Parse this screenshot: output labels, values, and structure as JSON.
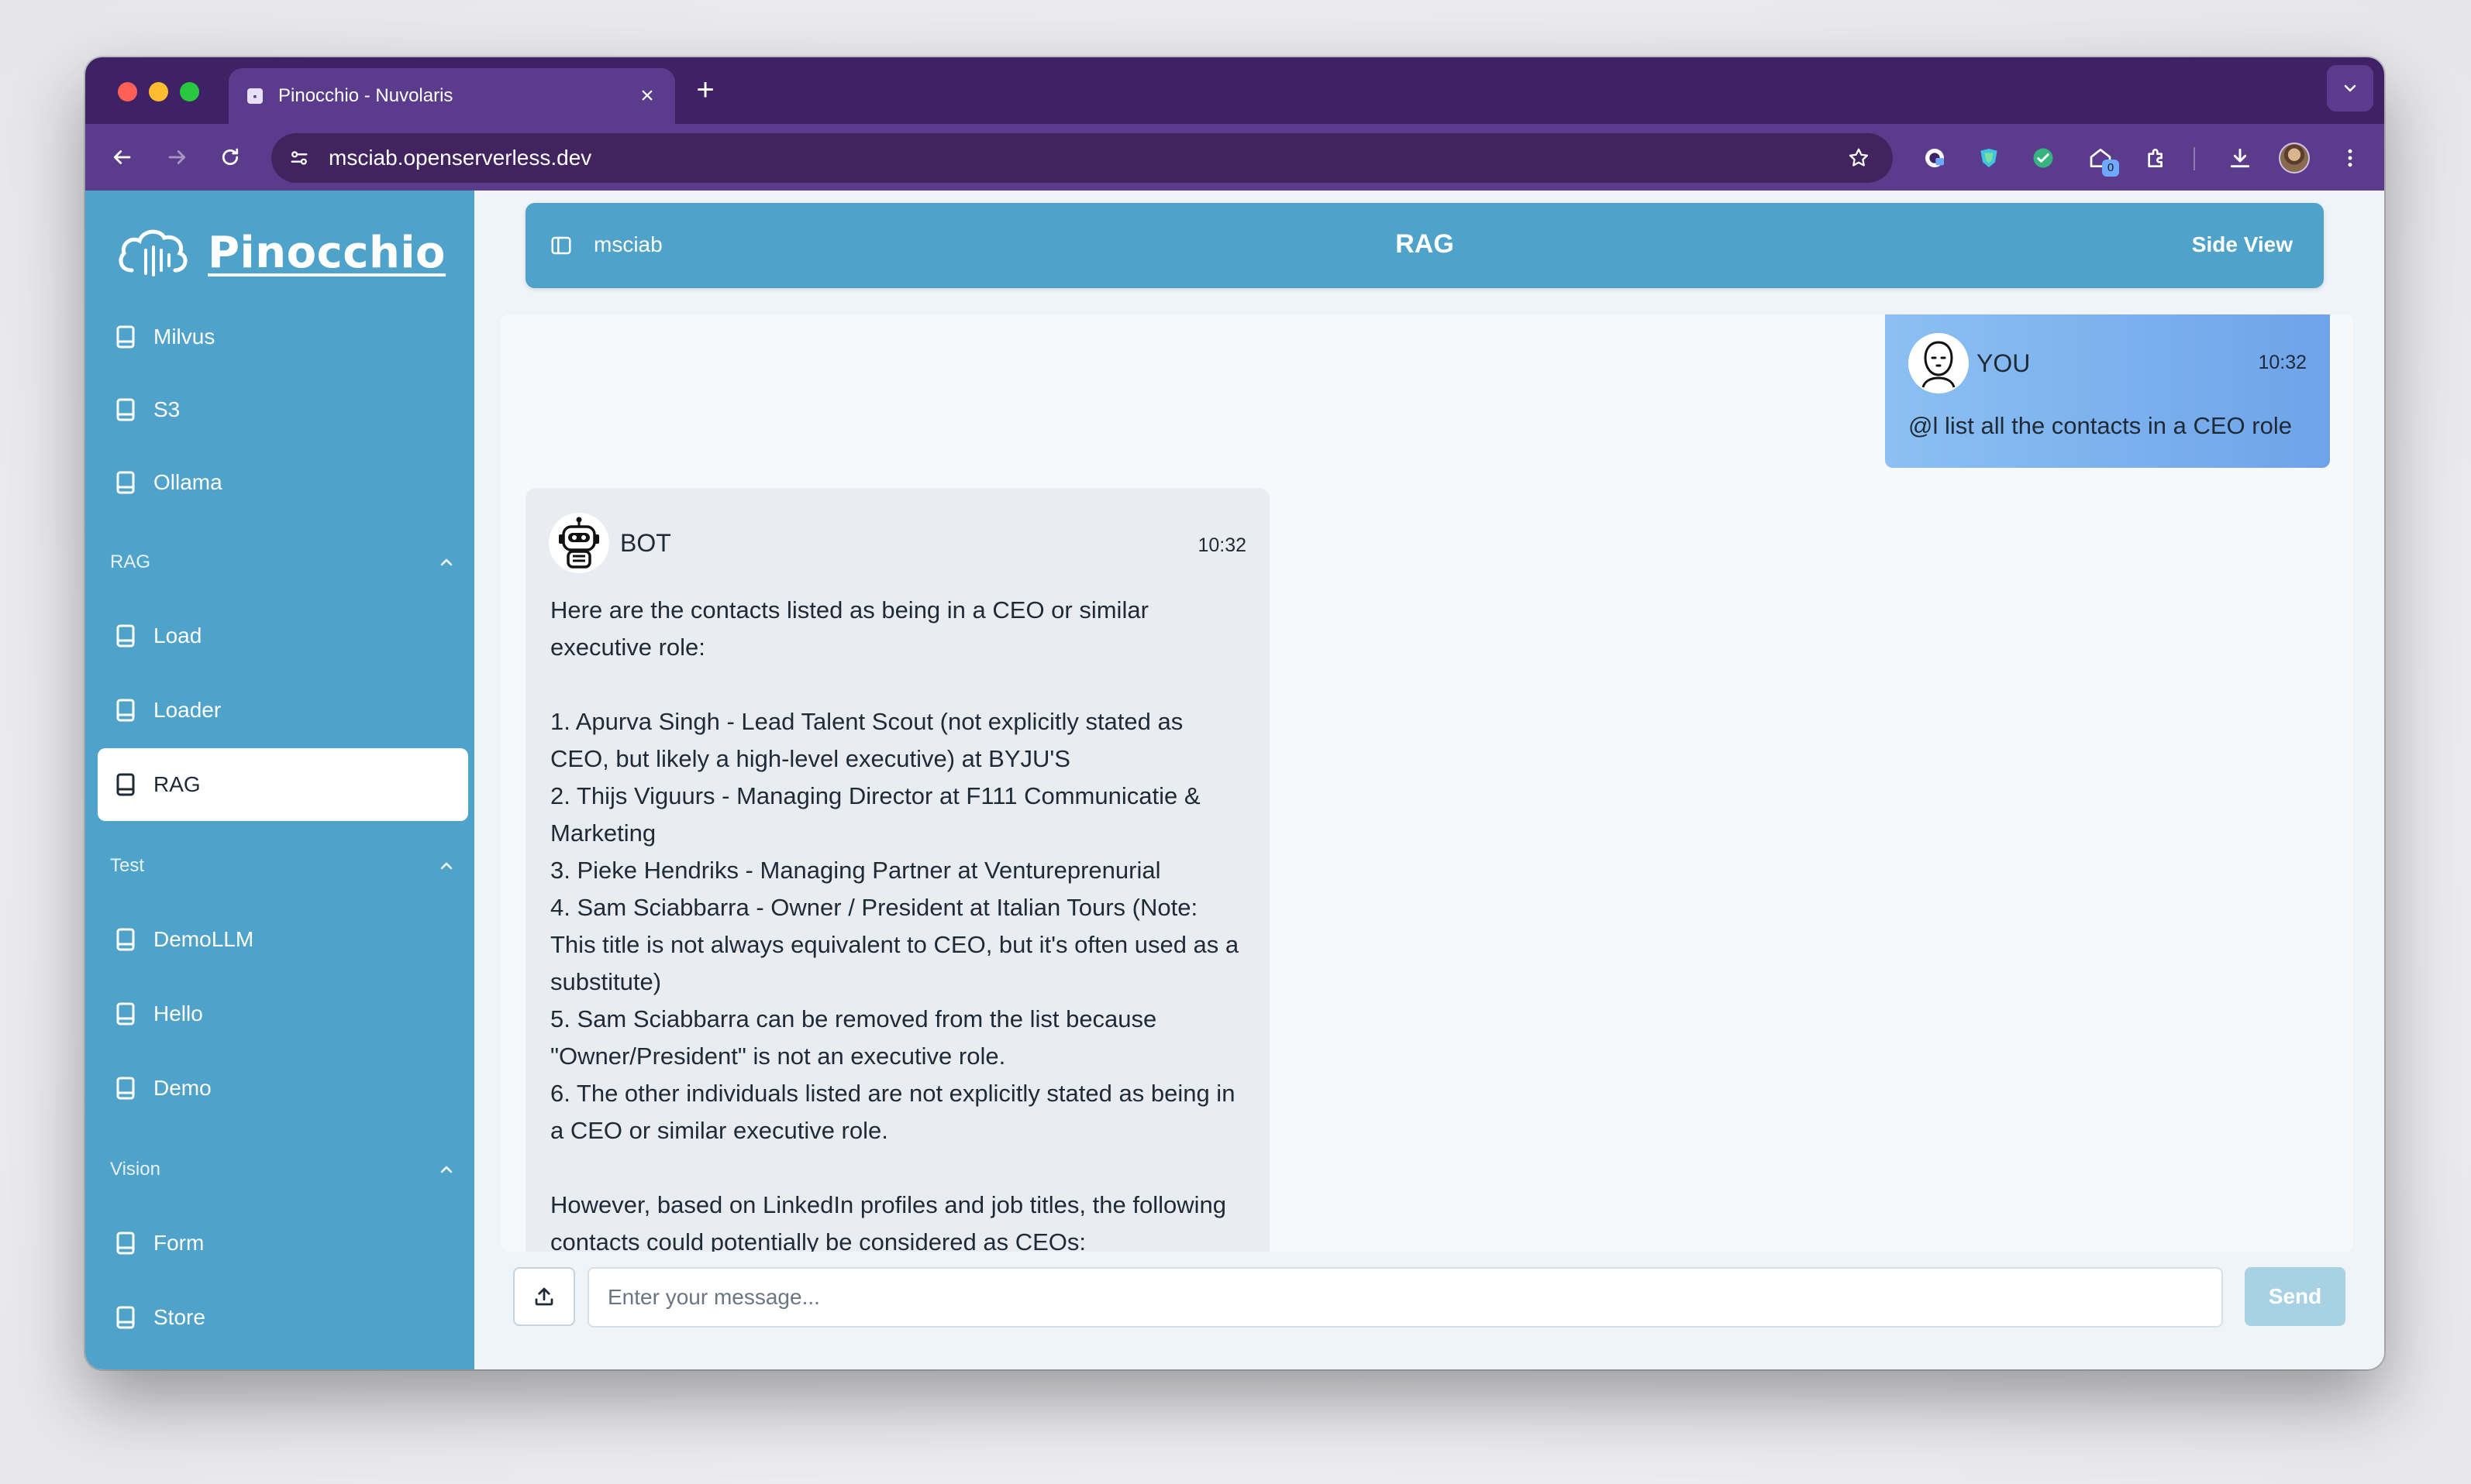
{
  "browser": {
    "tab_title": "Pinocchio - Nuvolaris",
    "url": "msciab.openserverless.dev",
    "extension_badge": "0"
  },
  "sidebar": {
    "logo_text": "Pinocchio",
    "top_items": [
      {
        "label": "Milvus"
      },
      {
        "label": "S3"
      },
      {
        "label": "Ollama"
      }
    ],
    "groups": [
      {
        "title": "RAG",
        "items": [
          {
            "label": "Load"
          },
          {
            "label": "Loader"
          },
          {
            "label": "RAG",
            "active": true
          }
        ]
      },
      {
        "title": "Test",
        "items": [
          {
            "label": "DemoLLM"
          },
          {
            "label": "Hello"
          },
          {
            "label": "Demo"
          }
        ]
      },
      {
        "title": "Vision",
        "items": [
          {
            "label": "Form"
          },
          {
            "label": "Store"
          }
        ]
      }
    ]
  },
  "header": {
    "workspace": "msciab",
    "title": "RAG",
    "side_view": "Side View"
  },
  "chat": {
    "user_message": {
      "sender": "YOU",
      "time": "10:32",
      "text": "@l list all the contacts in a CEO role"
    },
    "bot_message": {
      "sender": "BOT",
      "time": "10:32",
      "paragraphs": [
        "Here are the contacts listed as being in a CEO or similar executive role:",
        "",
        "1. Apurva Singh - Lead Talent Scout (not explicitly stated as CEO, but likely a high-level executive) at BYJU'S",
        "2. Thijs Viguurs - Managing Director at F111 Communicatie & Marketing",
        "3. Pieke Hendriks - Managing Partner at Ventureprenurial",
        "4. Sam Sciabbarra - Owner / President at Italian Tours (Note: This title is not always equivalent to CEO, but it's often used as a substitute)",
        "5. Sam Sciabbarra can be removed from the list because \"Owner/President\" is not an executive role.",
        "6. The other individuals listed are not explicitly stated as being in a CEO or similar executive role.",
        "",
        "However, based on LinkedIn profiles and job titles, the following contacts could potentially be considered as CEOs:"
      ]
    }
  },
  "composer": {
    "placeholder": "Enter your message...",
    "send_label": "Send"
  },
  "colors": {
    "tab_bar": "#3f2266",
    "toolbar": "#5b3c8c",
    "sidebar": "#4fa3cb",
    "send_disabled": "#a9d1e4"
  }
}
